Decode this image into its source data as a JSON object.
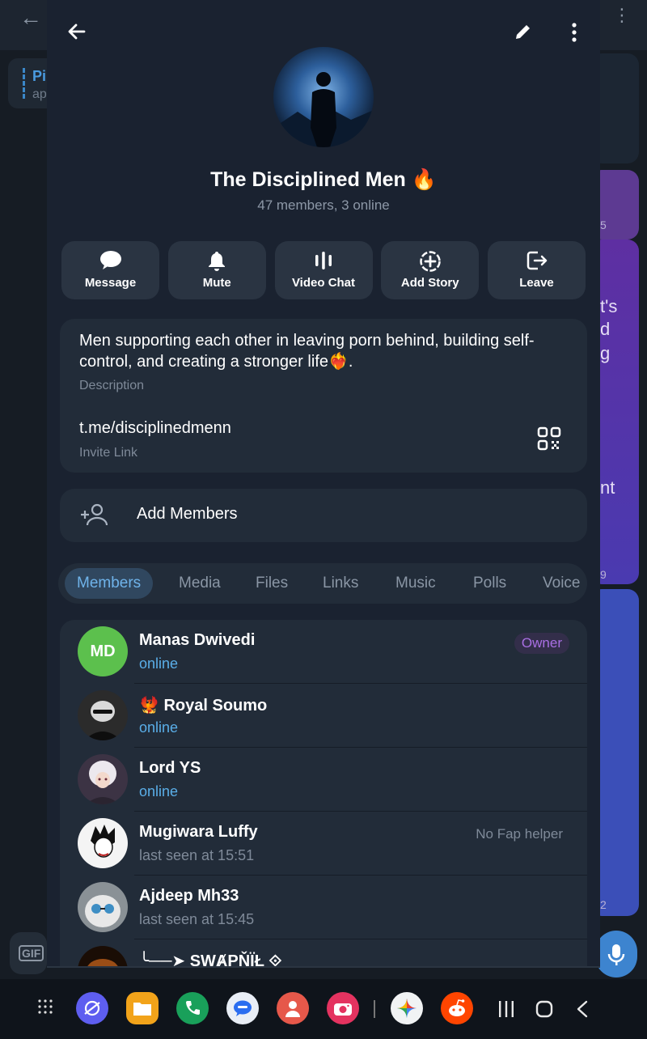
{
  "group": {
    "name": "The Disciplined Men",
    "emoji": "🔥",
    "subtitle": "47 members, 3 online"
  },
  "actions": [
    {
      "label": "Message",
      "icon": "message-icon"
    },
    {
      "label": "Mute",
      "icon": "bell-icon"
    },
    {
      "label": "Video Chat",
      "icon": "voice-chat-icon"
    },
    {
      "label": "Add Story",
      "icon": "add-story-icon"
    },
    {
      "label": "Leave",
      "icon": "leave-icon"
    }
  ],
  "info": {
    "description": "Men supporting each other in leaving porn behind, building self-control, and creating a stronger life❤️‍🔥.",
    "description_label": "Description",
    "invite_link": "t.me/disciplinedmenn",
    "invite_link_label": "Invite Link"
  },
  "add_members_label": "Add Members",
  "tabs": [
    "Members",
    "Media",
    "Files",
    "Links",
    "Music",
    "Polls",
    "Voice"
  ],
  "members": [
    {
      "name": "Manas Dwivedi",
      "status": "online",
      "badge": "Owner",
      "initials": "MD"
    },
    {
      "name": "Royal Soumo",
      "name_prefix": "🐦‍🔥",
      "status": "online"
    },
    {
      "name": "Lord YS",
      "status": "online"
    },
    {
      "name": "Mugiwara Luffy",
      "status": "last seen at 15:51",
      "role": "No Fap helper"
    },
    {
      "name": "Ajdeep Mh33",
      "status": "last seen at 15:45"
    },
    {
      "name": "╰──➤ ŞWȺPŇÏŁ ⟐",
      "status": ""
    }
  ],
  "background": {
    "pinned_title": "Pi",
    "pinned_sub": "ap",
    "msg_fragments": [
      "t's",
      "d",
      "g",
      "nt"
    ],
    "gif_label": "GIF",
    "times": [
      "5",
      "9",
      "2"
    ]
  },
  "colors": {
    "panel": "#1a2230",
    "card": "#222c39",
    "accent": "#5aaee8",
    "owner_badge": "#a96fe3",
    "md_avatar": "#5cc04d"
  }
}
